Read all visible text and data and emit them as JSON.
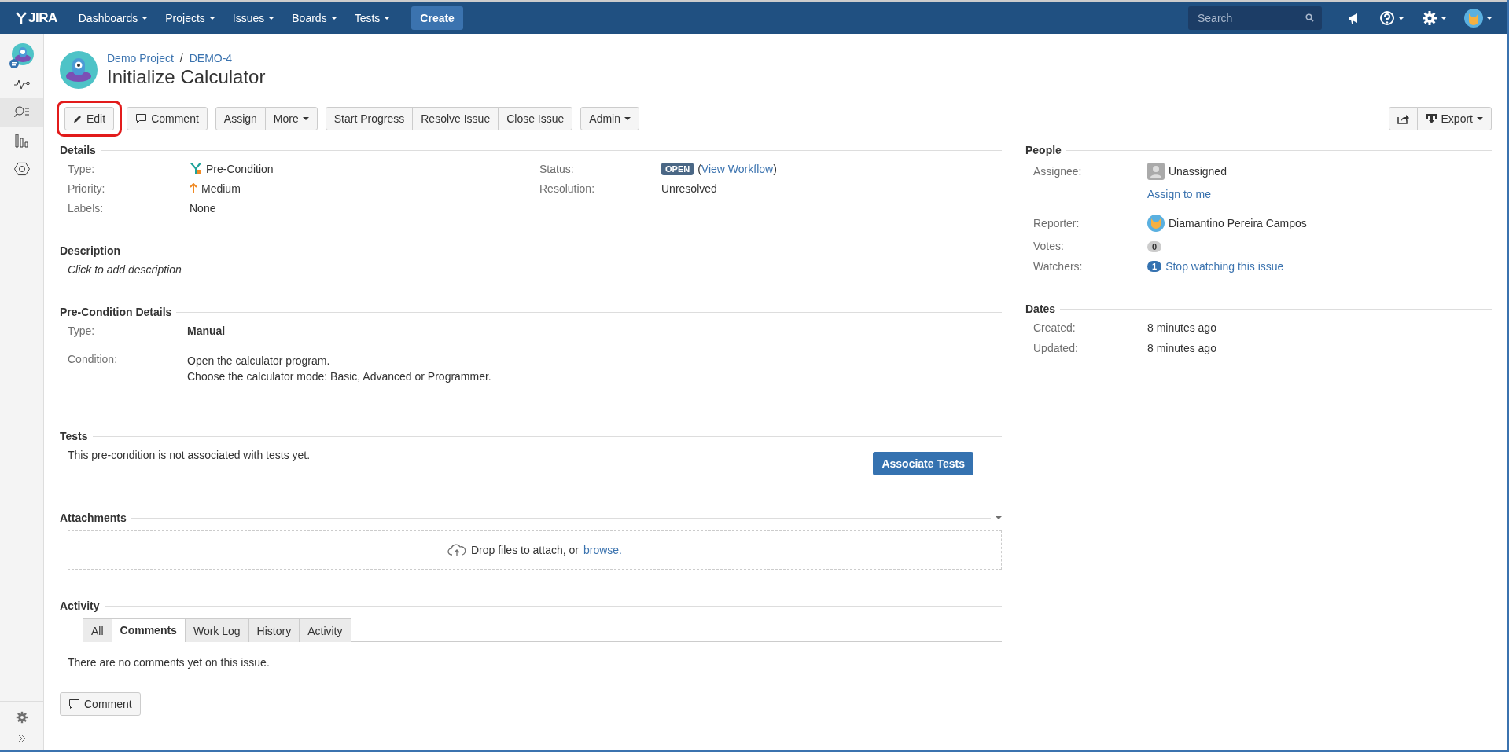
{
  "nav": {
    "logo": "JIRA",
    "menus": [
      {
        "label": "Dashboards"
      },
      {
        "label": "Projects"
      },
      {
        "label": "Issues"
      },
      {
        "label": "Boards"
      },
      {
        "label": "Tests"
      }
    ],
    "create": "Create",
    "search": {
      "placeholder": "Search"
    }
  },
  "header": {
    "project": "Demo Project",
    "separator": "/",
    "key": "DEMO-4",
    "title": "Initialize Calculator"
  },
  "toolbar": {
    "groups": [
      [
        {
          "label": "Edit",
          "kind": "edit",
          "highlighted": true
        }
      ],
      [
        {
          "label": "Comment",
          "kind": "comment",
          "highlighted": false
        }
      ],
      [
        {
          "label": "Assign",
          "kind": "plain",
          "highlighted": false
        },
        {
          "label": "More",
          "kind": "dropdown",
          "highlighted": false
        }
      ],
      [
        {
          "label": "Start Progress",
          "kind": "plain",
          "highlighted": false
        },
        {
          "label": "Resolve Issue",
          "kind": "plain",
          "highlighted": false
        },
        {
          "label": "Close Issue",
          "kind": "plain",
          "highlighted": false
        }
      ],
      [
        {
          "label": "Admin",
          "kind": "dropdown",
          "highlighted": false
        }
      ]
    ],
    "right": [
      {
        "kind": "share"
      },
      {
        "label": "Export",
        "kind": "export"
      }
    ]
  },
  "details": {
    "heading": "Details",
    "left": [
      {
        "label": "Type:",
        "value": "Pre-Condition",
        "kind": "type"
      },
      {
        "label": "Priority:",
        "value": "Medium",
        "kind": "priority"
      },
      {
        "label": "Labels:",
        "value": "None",
        "kind": "plain"
      }
    ],
    "right": [
      {
        "label": "Status:",
        "lozenge": "OPEN",
        "open_paren": "(",
        "link": "View Workflow",
        "close_paren": ")",
        "kind": "status"
      },
      {
        "label": "Resolution:",
        "value": "Unresolved",
        "kind": "plain"
      }
    ]
  },
  "description": {
    "heading": "Description",
    "placeholder": "Click to add description"
  },
  "precondition": {
    "heading": "Pre-Condition Details",
    "type_label": "Type:",
    "type_value": "Manual",
    "condition_label": "Condition:",
    "condition_lines": [
      "Open the calculator program.",
      "Choose the calculator mode: Basic, Advanced or Programmer."
    ]
  },
  "tests": {
    "heading": "Tests",
    "message": "This pre-condition is not associated with tests yet.",
    "button": "Associate Tests"
  },
  "attachments": {
    "heading": "Attachments",
    "drop_text": "Drop files to attach, or",
    "browse": "browse."
  },
  "activity": {
    "heading": "Activity",
    "tabs": [
      {
        "label": "All",
        "selected": false
      },
      {
        "label": "Comments",
        "selected": true
      },
      {
        "label": "Work Log",
        "selected": false
      },
      {
        "label": "History",
        "selected": false
      },
      {
        "label": "Activity",
        "selected": false
      }
    ],
    "empty": "There are no comments yet on this issue.",
    "comment_button": "Comment"
  },
  "people": {
    "heading": "People",
    "assignee_label": "Assignee:",
    "assignee": "Unassigned",
    "assign_link": "Assign to me",
    "reporter_label": "Reporter:",
    "reporter": "Diamantino Pereira Campos",
    "votes_label": "Votes:",
    "votes": "0",
    "watchers_label": "Watchers:",
    "watchers": "1",
    "watch_link": "Stop watching this issue"
  },
  "dates": {
    "heading": "Dates",
    "rows": [
      {
        "label": "Created:",
        "value": "8 minutes ago"
      },
      {
        "label": "Updated:",
        "value": "8 minutes ago"
      }
    ]
  }
}
